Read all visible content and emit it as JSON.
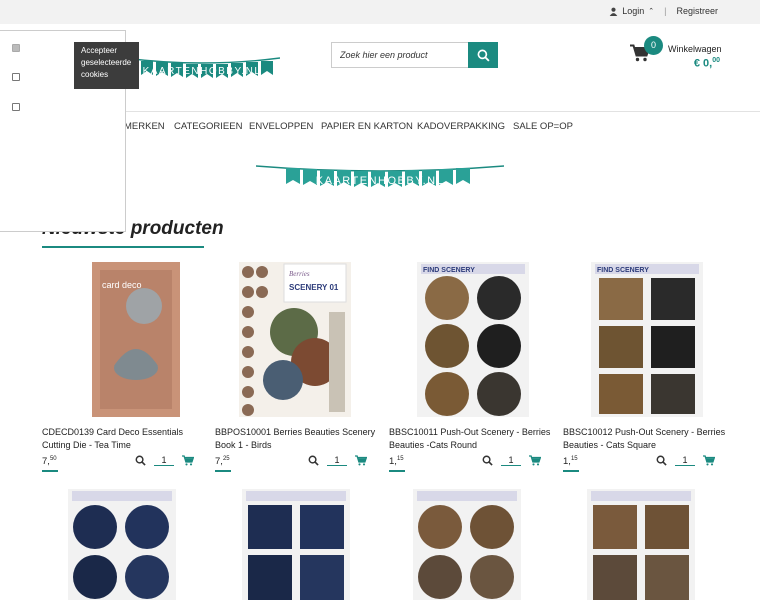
{
  "topbar": {
    "login_label": "Login",
    "register_label": "Registreer"
  },
  "search": {
    "placeholder": "Zoek hier een product"
  },
  "cart": {
    "count": "0",
    "label": "Winkelwagen",
    "total_main": "€ 0,",
    "total_cents": "00"
  },
  "logo": {
    "text": "KAARTENHOBBY.NL"
  },
  "nav": {
    "items": [
      "MERKEN",
      "CATEGORIEEN",
      "ENVELOPPEN",
      "PAPIER EN KARTON",
      "KADOVERPAKKING",
      "SALE OP=OP"
    ]
  },
  "banner": {
    "text": "KAARTENHOBBY.NL"
  },
  "section": {
    "title": "Nieuwste producten"
  },
  "products": [
    {
      "name": "CDECD0139 Card Deco Essentials Cutting Die - Tea Time",
      "price_main": "7,",
      "price_cents": "50"
    },
    {
      "name": "BBPOS10001 Berries Beauties Scenery Book 1 - Birds",
      "price_main": "7,",
      "price_cents": "25"
    },
    {
      "name": "BBSC10011 Push-Out Scenery - Berries Beauties -Cats Round",
      "price_main": "1,",
      "price_cents": "15"
    },
    {
      "name": "BBSC10012 Push-Out Scenery - Berries Beauties - Cats Square",
      "price_main": "1,",
      "price_cents": "15"
    }
  ],
  "qty_default": "1",
  "cookie": {
    "tooltip": "Accepteer geselecteerde cookies"
  },
  "colors": {
    "accent": "#1b8a80",
    "cookie_tooltip_bg": "#3c3c3c",
    "topbar_bg": "#f2f2f2"
  }
}
